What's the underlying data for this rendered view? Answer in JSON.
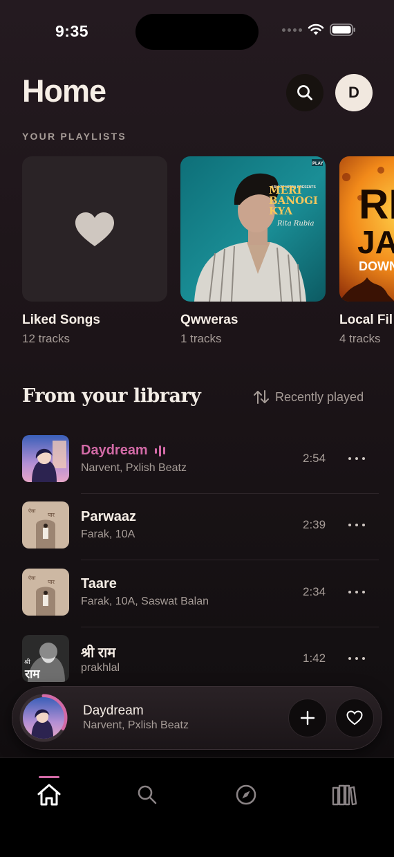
{
  "status_bar": {
    "time": "9:35"
  },
  "header": {
    "title": "Home",
    "avatar_initial": "D"
  },
  "playlists": {
    "section_label": "YOUR PLAYLISTS",
    "items": [
      {
        "name": "Liked Songs",
        "count": "12 tracks"
      },
      {
        "name": "Qwweras",
        "count": "1 tracks",
        "cover_title_lines": [
          "MERI",
          "BANOGI",
          "KYA"
        ],
        "cover_badge": "PLAY"
      },
      {
        "name": "Local Fil",
        "count": "4 tracks",
        "cover_title_lines": [
          "RI",
          "JAT",
          "DOWNLO"
        ]
      }
    ]
  },
  "library": {
    "title": "From your library",
    "sort_label": "Recently played",
    "tracks": [
      {
        "title": "Daydream",
        "artist": "Narvent, Pxlish Beatz",
        "duration": "2:54",
        "playing": true
      },
      {
        "title": "Parwaaz",
        "artist": "Farak, 10A",
        "duration": "2:39"
      },
      {
        "title": "Taare",
        "artist": "Farak, 10A, Saswat Balan",
        "duration": "2:34"
      },
      {
        "title": "श्री राम",
        "artist": "prakhlal",
        "duration": "1:42"
      }
    ]
  },
  "now_playing": {
    "title": "Daydream",
    "artist": "Narvent, Pxlish Beatz",
    "progress_percent": 33
  },
  "tab_bar": {
    "active": "home",
    "tabs": [
      {
        "name": "home",
        "icon": "home-icon"
      },
      {
        "name": "search",
        "icon": "search-icon"
      },
      {
        "name": "explore",
        "icon": "compass-icon"
      },
      {
        "name": "library",
        "icon": "library-icon"
      }
    ]
  },
  "colors": {
    "accent": "#d26aa6",
    "text_primary": "#f6eee6",
    "text_secondary": "#a69c97",
    "background": "#1c1418"
  }
}
